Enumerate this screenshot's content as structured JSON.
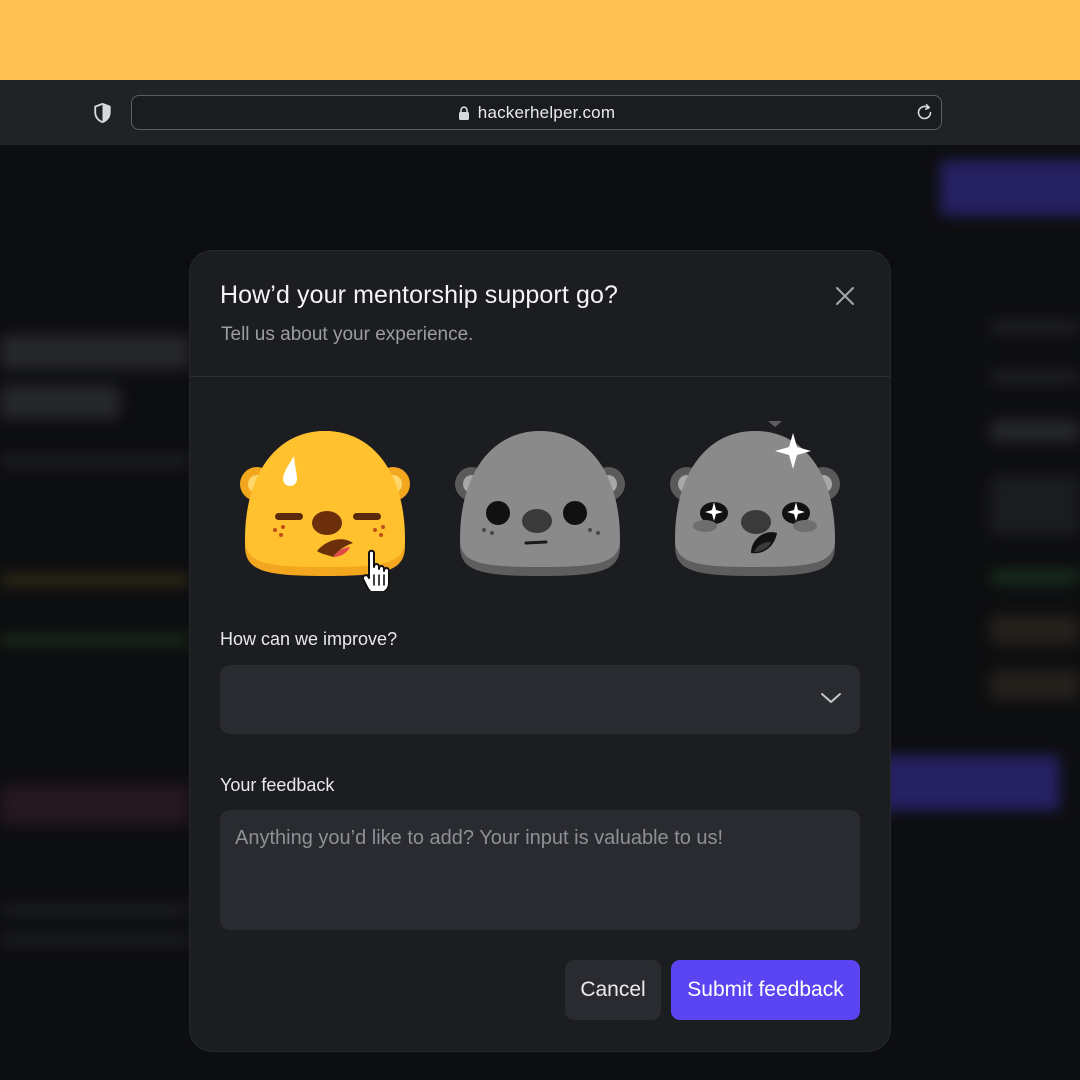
{
  "browser": {
    "url": "hackerhelper.com",
    "icons": [
      "shield-icon",
      "lock-icon",
      "reload-icon"
    ]
  },
  "modal": {
    "title": "How’d your mentorship support go?",
    "subtitle": "Tell us about your experience.",
    "close_icon": "close-icon",
    "ratings": [
      {
        "name": "unhappy",
        "selected": true,
        "color": "#ffc12e"
      },
      {
        "name": "neutral",
        "selected": false,
        "color": "#8a8a8a"
      },
      {
        "name": "delighted",
        "selected": false,
        "color": "#8a8a8a"
      }
    ],
    "improve": {
      "label": "How can we improve?",
      "value": ""
    },
    "feedback": {
      "label": "Your feedback",
      "placeholder": "Anything you’d like to add? Your input is valuable to us!"
    },
    "cancel_label": "Cancel",
    "submit_label": "Submit feedback"
  },
  "colors": {
    "top_band": "#ffc152",
    "accent": "#5b45f2",
    "modal_bg": "#1c1d21",
    "field_bg": "#2a2b30"
  }
}
